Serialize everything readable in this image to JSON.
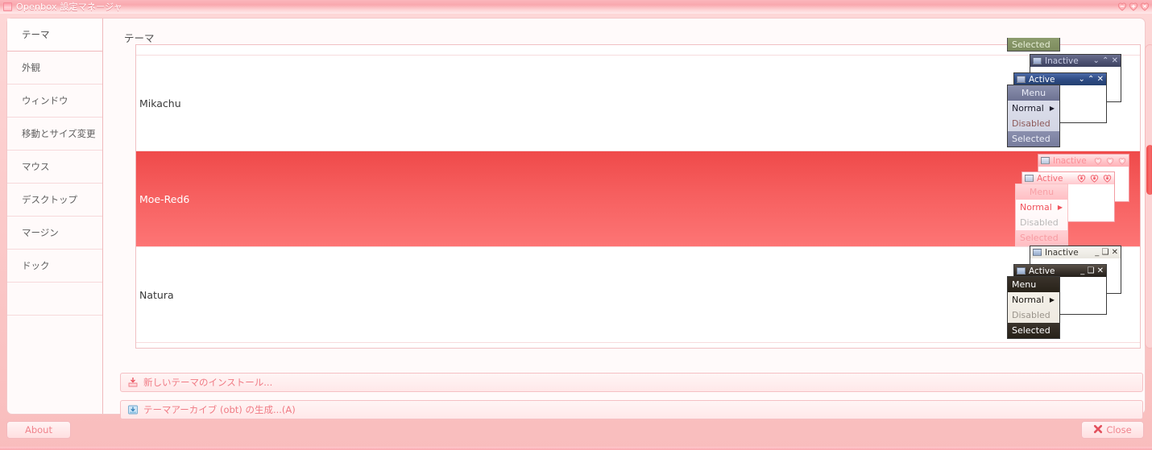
{
  "window": {
    "title": "Openbox 設定マネージャ",
    "icon": "app-icon",
    "buttons": [
      {
        "name": "minimize",
        "glyph": "–"
      },
      {
        "name": "maximize",
        "glyph": "+"
      },
      {
        "name": "close",
        "glyph": "×"
      }
    ]
  },
  "sidebar": {
    "items": [
      {
        "label": "テーマ",
        "selected": true
      },
      {
        "label": "外観",
        "selected": false
      },
      {
        "label": "ウィンドウ",
        "selected": false
      },
      {
        "label": "移動とサイズ変更",
        "selected": false
      },
      {
        "label": "マウス",
        "selected": false
      },
      {
        "label": "デスクトップ",
        "selected": false
      },
      {
        "label": "マージン",
        "selected": false
      },
      {
        "label": "ドック",
        "selected": false
      }
    ]
  },
  "pane": {
    "title": "テーマ",
    "themes": [
      {
        "name": "Mikachu",
        "selected": false
      },
      {
        "name": "Moe-Red6",
        "selected": true
      },
      {
        "name": "Natura",
        "selected": false
      }
    ],
    "previews": {
      "partial_top": {
        "selected_label": "Selected"
      },
      "mikachu": {
        "inactive_label": "Inactive",
        "active_label": "Active",
        "inactive_buttons": "⌄ ⌃ ✕",
        "active_buttons": "⌄ ⌃ ✕",
        "menu_header": "Menu",
        "menu_normal": "Normal",
        "menu_disabled": "Disabled",
        "menu_selected": "Selected",
        "submenu_arrow": "▶"
      },
      "moered6": {
        "inactive_label": "Inactive",
        "active_label": "Active",
        "inactive_buttons": "− + ×",
        "active_buttons": "♥ ♥ ♥",
        "menu_header": "Menu",
        "menu_normal": "Normal",
        "menu_disabled": "Disabled",
        "menu_selected": "Selected",
        "submenu_arrow": "▶"
      },
      "natura": {
        "inactive_label": "Inactive",
        "active_label": "Active",
        "inactive_buttons": "_ ❑ ✕",
        "active_buttons": "_ ❑ ✕",
        "menu_header": "Menu",
        "menu_normal": "Normal",
        "menu_disabled": "Disabled",
        "menu_selected": "Selected",
        "submenu_arrow": "▶"
      }
    },
    "actions": {
      "install_label": "新しいテーマのインストール...",
      "install_icon": "install-theme-icon",
      "archive_label": "テーマアーカイブ (obt) の生成...(A)",
      "archive_icon": "archive-theme-icon"
    },
    "scrollbar": {
      "thumb_top_pct": 33,
      "thumb_height_pct": 16
    }
  },
  "footer": {
    "about_label": "About",
    "close_label": "Close",
    "close_icon": "close-x-icon"
  },
  "colors": {
    "accent": "#f46a74",
    "selected_row_top": "#ef4a4a",
    "selected_row_bottom": "#fd7575",
    "titlebar": "#f9a8ae",
    "panel_bg": "#fffafa",
    "border": "#f0b9bc"
  }
}
